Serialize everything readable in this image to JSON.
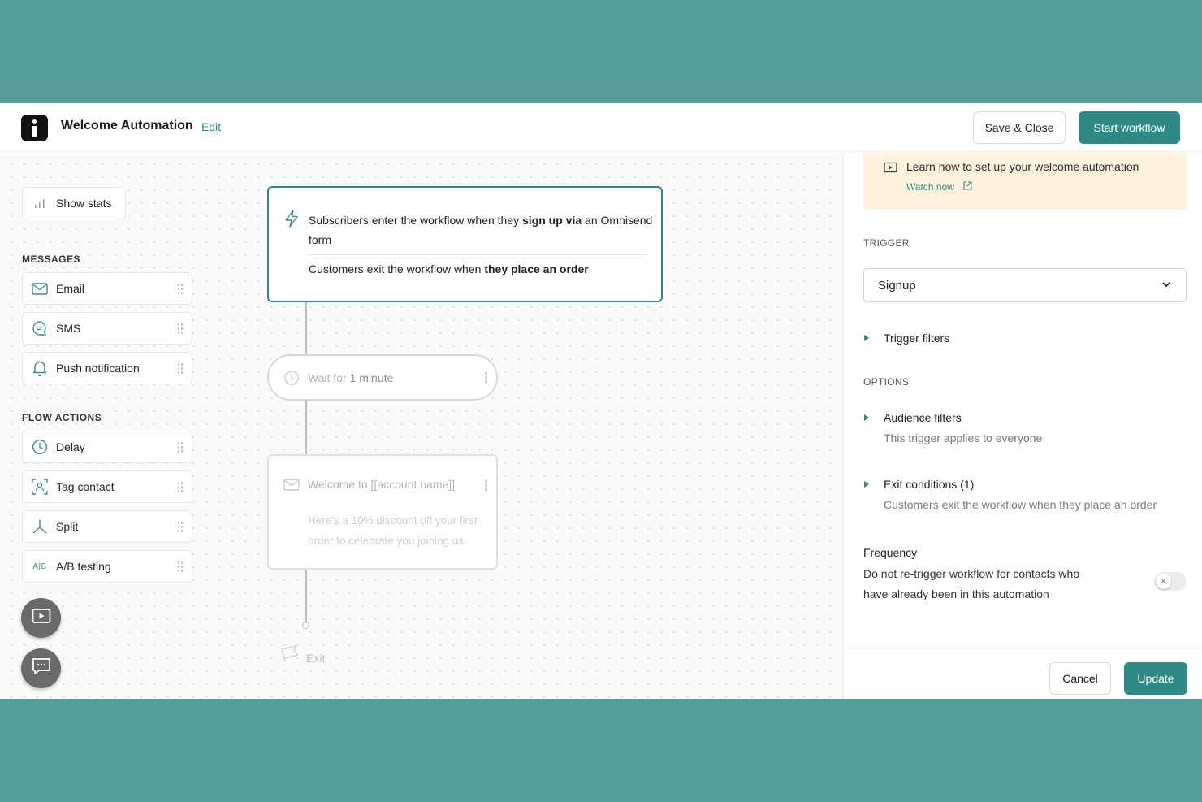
{
  "header": {
    "title": "Welcome Automation",
    "edit_label": "Edit",
    "save_close_label": "Save & Close",
    "start_label": "Start workflow"
  },
  "sidebar": {
    "show_stats": "Show stats",
    "messages_label": "MESSAGES",
    "messages": [
      {
        "label": "Email",
        "icon": "envelope-icon"
      },
      {
        "label": "SMS",
        "icon": "chat-bubble-icon"
      },
      {
        "label": "Push notification",
        "icon": "bell-icon"
      }
    ],
    "flow_actions_label": "FLOW ACTIONS",
    "flow_actions": [
      {
        "label": "Delay",
        "icon": "clock-icon"
      },
      {
        "label": "Tag contact",
        "icon": "tag-contact-icon"
      },
      {
        "label": "Split",
        "icon": "split-icon"
      },
      {
        "label": "A/B testing",
        "icon": "ab-testing-icon"
      }
    ],
    "ab_icon_text": "A|B"
  },
  "flow": {
    "trigger_enter_prefix": "Subscribers enter the workflow when they ",
    "trigger_enter_bold": "sign up via",
    "trigger_enter_suffix": " an Omnisend form",
    "trigger_exit_prefix": "Customers exit the workflow when ",
    "trigger_exit_bold": "they place an order",
    "wait_prefix": "Wait for ",
    "wait_value": "1 minute",
    "email_subject": "Welcome to [[account.name]]",
    "email_preview": "Here's a 10% discount off your first order to celebrate you joining us.",
    "exit_label": "Exit"
  },
  "panel": {
    "tip_text": "Learn how to set up your welcome automation",
    "tip_link": "Watch now",
    "trigger_label": "TRIGGER",
    "trigger_value": "Signup",
    "trigger_filters": "Trigger filters",
    "options_label": "OPTIONS",
    "audience_filters": "Audience filters",
    "audience_sub": "This trigger applies to everyone",
    "exit_conditions": "Exit conditions (1)",
    "exit_sub": "Customers exit the workflow when they place an order",
    "frequency_title": "Frequency",
    "frequency_text": "Do not re-trigger workflow for contacts who have already been in this automation",
    "toggle_glyph": "✕",
    "cancel_label": "Cancel",
    "update_label": "Update"
  },
  "colors": {
    "brand": "#2d8a84",
    "frame_background": "#559e98",
    "tip_background": "#fdf3dc"
  }
}
